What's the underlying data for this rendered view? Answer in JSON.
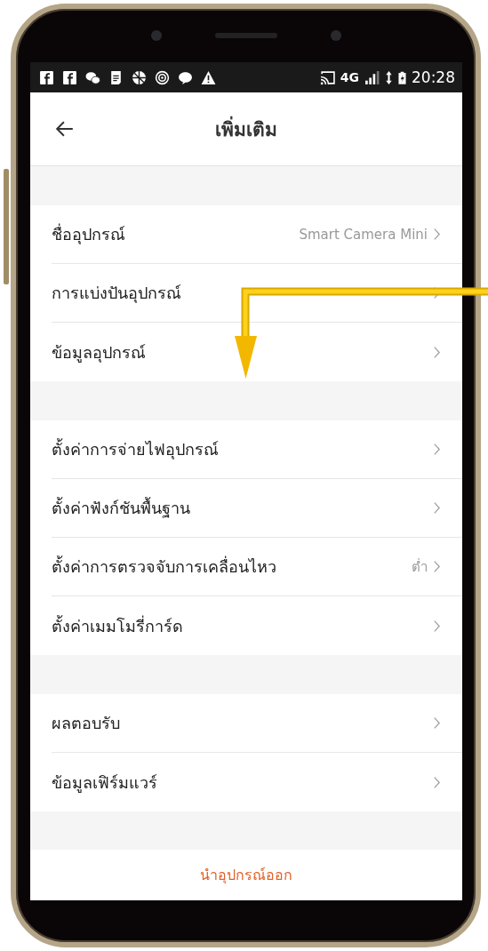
{
  "status_bar": {
    "network": "4G",
    "time": "20:28"
  },
  "header": {
    "title": "เพิ่มเติม"
  },
  "sections": [
    {
      "items": [
        {
          "label": "ชื่ออุปกรณ์",
          "value": "Smart Camera Mini"
        },
        {
          "label": "การแบ่งปันอุปกรณ์"
        },
        {
          "label": "ข้อมูลอุปกรณ์"
        }
      ]
    },
    {
      "items": [
        {
          "label": "ตั้งค่าการจ่ายไฟอุปกรณ์"
        },
        {
          "label": "ตั้งค่าฟังก์ชันพื้นฐาน"
        },
        {
          "label": "ตั้งค่าการตรวจจับการเคลื่อนไหว",
          "value": "ต่ำ"
        },
        {
          "label": "ตั้งค่าเมมโมรี่การ์ด"
        }
      ]
    },
    {
      "items": [
        {
          "label": "ผลตอบรับ"
        },
        {
          "label": "ข้อมูลเฟิร์มแวร์"
        }
      ]
    }
  ],
  "remove_button": "นำอุปกรณ์ออก"
}
